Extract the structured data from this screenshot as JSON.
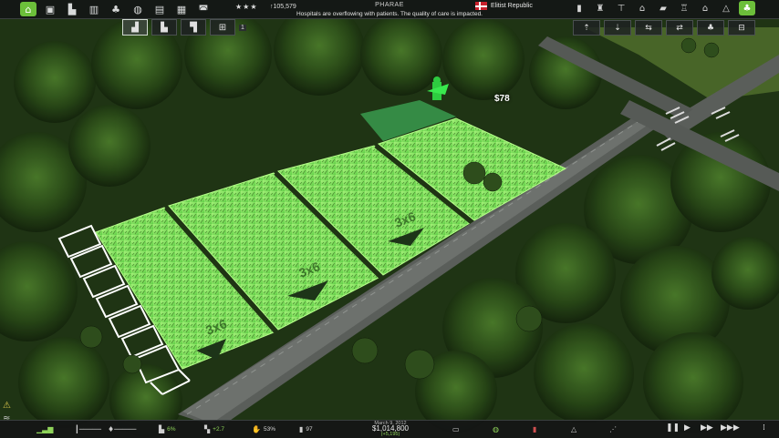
{
  "hud": {
    "stars": "★★★",
    "population": "↑105,579",
    "title": "PHARAE",
    "notice": "Hospitals are overflowing with patients. The quality of care is impacted.",
    "faction": "Elitist Republic",
    "flag_colors": [
      "#c8202b",
      "#ffffff"
    ],
    "left_icons": [
      "home-icon",
      "save-icon",
      "factory-icon",
      "building-icon",
      "tree-icon",
      "globe-icon",
      "document-icon",
      "map-icon",
      "vehicle-icon"
    ],
    "right_icons": [
      "cash-icon",
      "lamp-icon",
      "crane-icon",
      "house-icon",
      "bulldozer-icon",
      "tower-icon",
      "temple-icon",
      "triangle-icon",
      "palm-icon"
    ]
  },
  "build_menu": {
    "count": "1",
    "items": [
      "farm-small",
      "farm-medium",
      "farm-large",
      "cycle-layout"
    ]
  },
  "tool_buttons": [
    "raise-icon",
    "lower-icon",
    "rotate-left-icon",
    "rotate-right-icon",
    "trees-icon",
    "road-icon"
  ],
  "field_size_labels": [
    "3x6",
    "3x6",
    "3x6"
  ],
  "build_cost": "$78",
  "bottom": {
    "stat_1": "6%",
    "stat_2": "+2.7",
    "stat_3": "53%",
    "stat_4": "97",
    "date": "March 9, 2012",
    "money": "$1,014,800",
    "money_delta": "(+5,195)"
  },
  "colors": {
    "field": "#7be85a",
    "ui_bg": "#141616",
    "accent": "#6cbf3a"
  }
}
